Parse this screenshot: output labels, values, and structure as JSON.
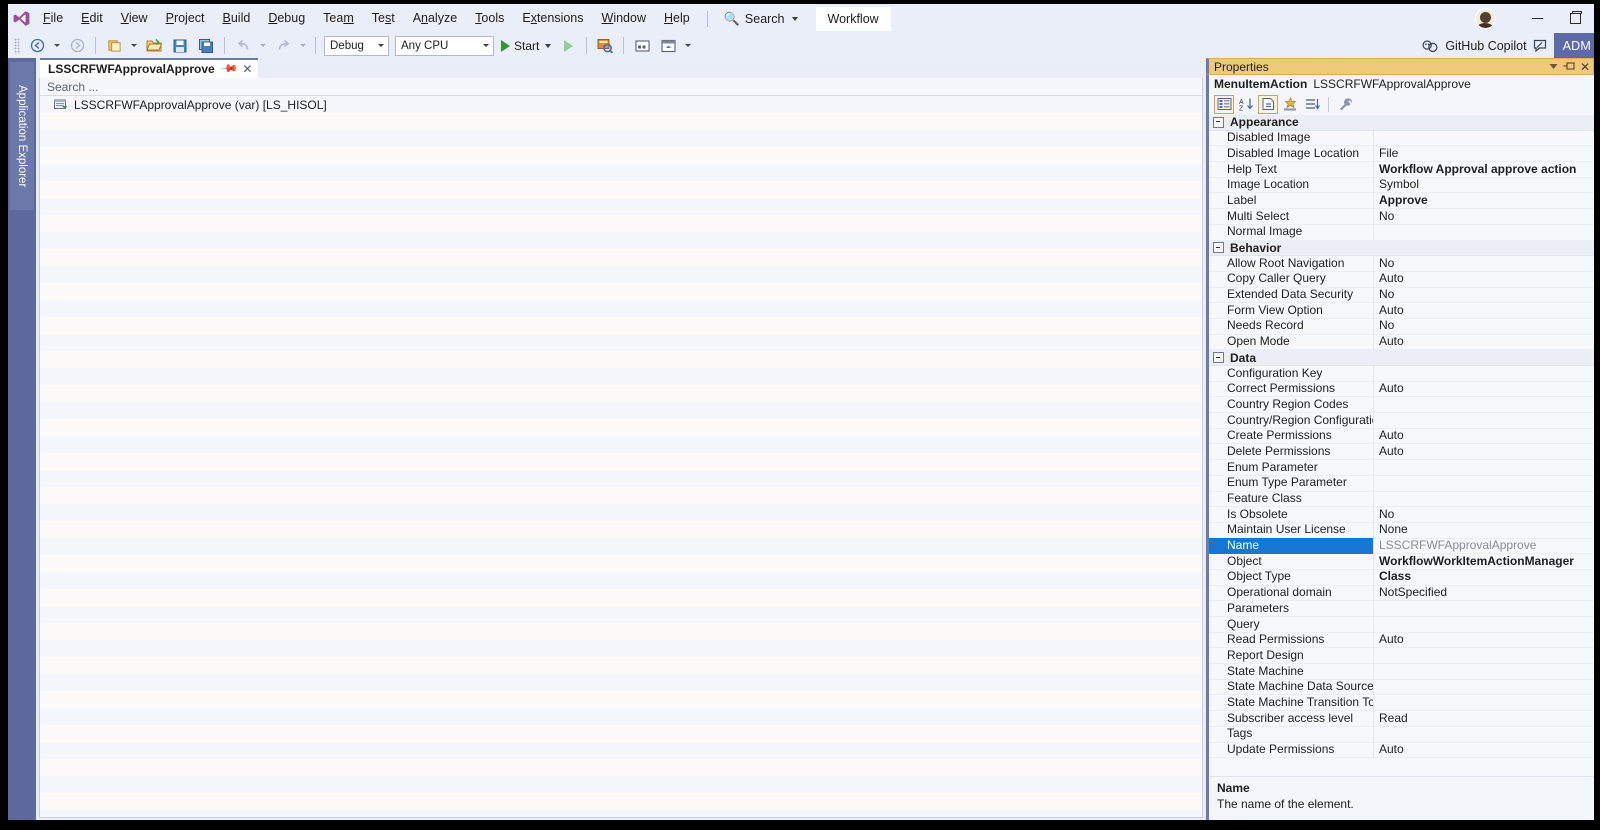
{
  "menu": {
    "items": [
      {
        "label": "File",
        "accel": "F"
      },
      {
        "label": "Edit",
        "accel": "E"
      },
      {
        "label": "View",
        "accel": "V"
      },
      {
        "label": "Project",
        "accel": "P"
      },
      {
        "label": "Build",
        "accel": "B"
      },
      {
        "label": "Debug",
        "accel": "D"
      },
      {
        "label": "Team",
        "accel": "m"
      },
      {
        "label": "Test",
        "accel": "s"
      },
      {
        "label": "Analyze",
        "accel": "n"
      },
      {
        "label": "Tools",
        "accel": "T"
      },
      {
        "label": "Extensions",
        "accel": "x"
      },
      {
        "label": "Window",
        "accel": "W"
      },
      {
        "label": "Help",
        "accel": "H"
      }
    ],
    "search_label": "Search",
    "workflow_tab": "Workflow"
  },
  "titlebar": {
    "minimize_tooltip": "Minimize",
    "restore_tooltip": "Restore Down"
  },
  "toolbar": {
    "config_value": "Debug",
    "platform_value": "Any CPU",
    "start_label": "Start",
    "copilot_label": "GitHub Copilot",
    "account_badge": "ADM"
  },
  "sidebar": {
    "vertical_tab": "Application Explorer"
  },
  "document": {
    "tab_title": "LSSCRFWFApprovalApprove",
    "search_placeholder": "Search ...",
    "tree": [
      {
        "label": "LSSCRFWFApprovalApprove (var) [LS_HISOL]",
        "icon": "project-node-icon"
      }
    ]
  },
  "properties": {
    "panel_title": "Properties",
    "subject_class": "MenuItemAction",
    "subject_name": "LSSCRFWFApprovalApprove",
    "toolbar_icons": [
      {
        "name": "categorized-icon",
        "active": true
      },
      {
        "name": "alphabetical-sort-icon",
        "active": false
      },
      {
        "name": "properties-page-icon",
        "active": true
      },
      {
        "name": "events-icon",
        "active": false
      },
      {
        "name": "property-pages-icon",
        "active": false
      },
      {
        "name": "wrench-icon",
        "active": false
      }
    ],
    "groups": [
      {
        "name": "Appearance",
        "rows": [
          {
            "name": "Disabled Image",
            "value": "",
            "bold": false
          },
          {
            "name": "Disabled Image Location",
            "value": "File",
            "bold": false
          },
          {
            "name": "Help Text",
            "value": "Workflow Approval approve action",
            "bold": true
          },
          {
            "name": "Image Location",
            "value": "Symbol",
            "bold": false
          },
          {
            "name": "Label",
            "value": "Approve",
            "bold": true
          },
          {
            "name": "Multi Select",
            "value": "No",
            "bold": false
          },
          {
            "name": "Normal Image",
            "value": "",
            "bold": false
          }
        ]
      },
      {
        "name": "Behavior",
        "rows": [
          {
            "name": "Allow Root Navigation",
            "value": "No",
            "bold": false
          },
          {
            "name": "Copy Caller Query",
            "value": "Auto",
            "bold": false
          },
          {
            "name": "Extended Data Security",
            "value": "No",
            "bold": false
          },
          {
            "name": "Form View Option",
            "value": "Auto",
            "bold": false
          },
          {
            "name": "Needs Record",
            "value": "No",
            "bold": false
          },
          {
            "name": "Open Mode",
            "value": "Auto",
            "bold": false
          }
        ]
      },
      {
        "name": "Data",
        "rows": [
          {
            "name": "Configuration Key",
            "value": "",
            "bold": false
          },
          {
            "name": "Correct Permissions",
            "value": "Auto",
            "bold": false
          },
          {
            "name": "Country Region Codes",
            "value": "",
            "bold": false
          },
          {
            "name": "Country/Region Configuration Ke",
            "value": "",
            "bold": false
          },
          {
            "name": "Create Permissions",
            "value": "Auto",
            "bold": false
          },
          {
            "name": "Delete Permissions",
            "value": "Auto",
            "bold": false
          },
          {
            "name": "Enum Parameter",
            "value": "",
            "bold": false
          },
          {
            "name": "Enum Type Parameter",
            "value": "",
            "bold": false
          },
          {
            "name": "Feature Class",
            "value": "",
            "bold": false
          },
          {
            "name": "Is Obsolete",
            "value": "No",
            "bold": false
          },
          {
            "name": "Maintain User License",
            "value": "None",
            "bold": false
          },
          {
            "name": "Name",
            "value": "LSSCRFWFApprovalApprove",
            "bold": false,
            "selected": true
          },
          {
            "name": "Object",
            "value": "WorkflowWorkItemActionManager",
            "bold": true
          },
          {
            "name": "Object Type",
            "value": "Class",
            "bold": true
          },
          {
            "name": "Operational domain",
            "value": "NotSpecified",
            "bold": false
          },
          {
            "name": "Parameters",
            "value": "",
            "bold": false
          },
          {
            "name": "Query",
            "value": "",
            "bold": false
          },
          {
            "name": "Read Permissions",
            "value": "Auto",
            "bold": false
          },
          {
            "name": "Report Design",
            "value": "",
            "bold": false
          },
          {
            "name": "State Machine",
            "value": "",
            "bold": false
          },
          {
            "name": "State Machine Data Source",
            "value": "",
            "bold": false
          },
          {
            "name": "State Machine Transition To",
            "value": "",
            "bold": false
          },
          {
            "name": "Subscriber access level",
            "value": "Read",
            "bold": false
          },
          {
            "name": "Tags",
            "value": "",
            "bold": false
          },
          {
            "name": "Update Permissions",
            "value": "Auto",
            "bold": false
          }
        ]
      }
    ],
    "description_title": "Name",
    "description_text": "The name of the element."
  },
  "colors": {
    "menu_bg": "#eaeef9",
    "panel_title_bg": "#f0c87a",
    "selection_blue": "#1577d1",
    "rail_purple": "#6c79ab",
    "accent_badge": "#5c6aa8"
  }
}
